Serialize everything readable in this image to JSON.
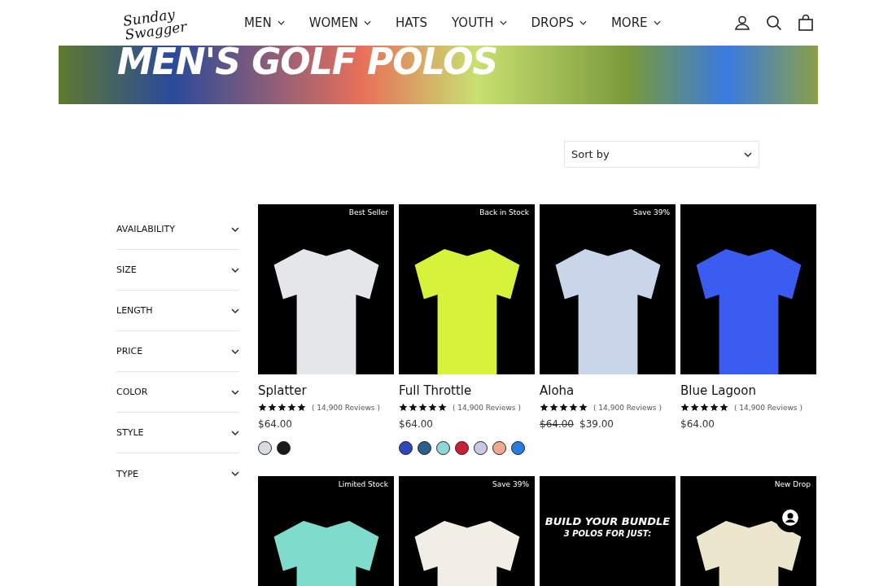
{
  "header": {
    "logo": "Sunday Swagger",
    "nav": [
      {
        "label": "MEN",
        "dropdown": true
      },
      {
        "label": "WOMEN",
        "dropdown": true
      },
      {
        "label": "HATS",
        "dropdown": false
      },
      {
        "label": "YOUTH",
        "dropdown": true
      },
      {
        "label": "DROPS",
        "dropdown": true
      },
      {
        "label": "MORE",
        "dropdown": true
      }
    ]
  },
  "banner": {
    "title": "MEN'S GOLF POLOS"
  },
  "sort": {
    "label": "Sort by"
  },
  "filters": [
    {
      "label": "AVAILABILITY",
      "expanded": false
    },
    {
      "label": "SIZE",
      "expanded": false
    },
    {
      "label": "LENGTH",
      "expanded": false
    },
    {
      "label": "PRICE",
      "expanded": false
    },
    {
      "label": "COLOR",
      "expanded": false
    },
    {
      "label": "STYLE",
      "expanded": false
    },
    {
      "label": "TYPE",
      "expanded": false
    }
  ],
  "products": [
    {
      "kind": "product",
      "badge": "Best Seller",
      "color": "#e4e6ea",
      "name": "Splatter",
      "stars": 5,
      "reviews": "( 14,900 Reviews )",
      "price": "$64.00",
      "swatches": [
        {
          "color": "#d8dbe0"
        },
        {
          "color": "#1a1a1a"
        }
      ]
    },
    {
      "kind": "product",
      "badge": "Back in Stock",
      "color": "#d6f23a",
      "name": "Full Throttle",
      "stars": 5,
      "reviews": "( 14,900 Reviews )",
      "price": "$64.00",
      "swatches": [
        {
          "color": "#2f47b8"
        },
        {
          "color": "#2e5e8c"
        },
        {
          "color": "#8fd6d4"
        },
        {
          "color": "#c8203a"
        },
        {
          "color": "#c9c8e2"
        },
        {
          "color": "#f0a890"
        },
        {
          "color": "#2a7be0"
        }
      ]
    },
    {
      "kind": "product",
      "badge": "Save 39%",
      "color": "#c9d6ea",
      "name": "Aloha",
      "stars": 5,
      "reviews": "( 14,900 Reviews )",
      "compare_price": "$64.00",
      "price": "$39.00"
    },
    {
      "kind": "product",
      "color": "#3b5cf0",
      "name": "Blue Lagoon",
      "stars": 5,
      "reviews": "( 14,900 Reviews )",
      "price": "$64.00"
    },
    {
      "kind": "product",
      "badge": "Limited Stock",
      "color": "#7fdccc"
    },
    {
      "kind": "product",
      "badge": "Save 39%",
      "color": "#f2eee6"
    },
    {
      "kind": "promo",
      "headline": "BUILD YOUR BUNDLE",
      "subline": "3 POLOS FOR JUST:"
    },
    {
      "kind": "product",
      "badge": "New Drop",
      "color": "#ece6cc"
    }
  ]
}
